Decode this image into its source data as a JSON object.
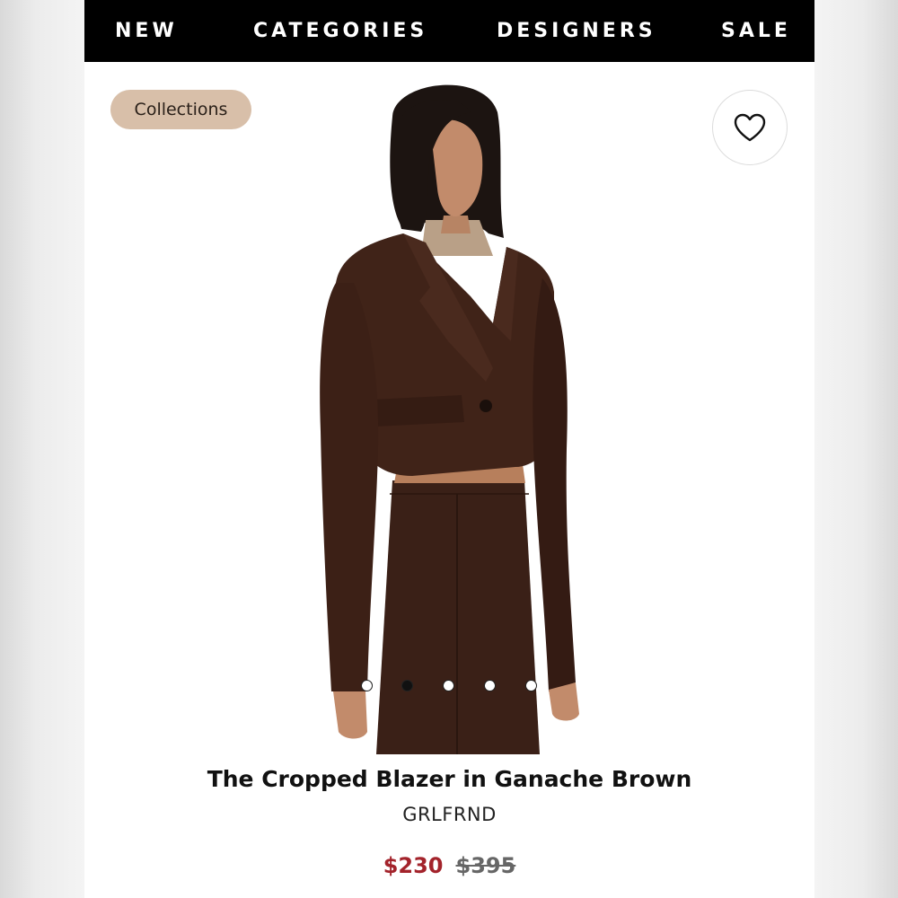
{
  "nav": {
    "items": [
      "NEW",
      "CATEGORIES",
      "DESIGNERS",
      "SALE"
    ]
  },
  "collections_chip": "Collections",
  "favorite": {
    "icon": "heart-icon"
  },
  "product": {
    "title": "The Cropped Blazer in Ganache Brown",
    "brand": "GRLFRND",
    "sale_price": "$230",
    "original_price": "$395",
    "image_total": 5,
    "image_active_index": 2
  },
  "colors": {
    "sale_price": "#a3232b",
    "chip_bg": "#d8bfa9",
    "nav_bg": "#000000",
    "blazer": "#3f2318"
  }
}
